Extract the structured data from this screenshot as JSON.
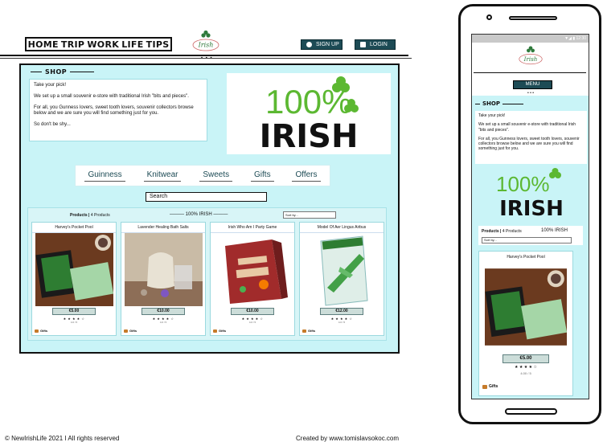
{
  "nav": {
    "items": [
      "HOME",
      "TRIP",
      "WORK",
      "LIFE",
      "TIPS"
    ]
  },
  "header": {
    "signup_label": "SIGN UP",
    "login_label": "LOGIN",
    "logo_text": "Irish",
    "dots": "• • •"
  },
  "shop": {
    "title": "SHOP",
    "intro": [
      "Take your pick!",
      "We set up a small souvenir e-store with traditional Irish \"bits and pieces\".",
      "For all, you Gunness lovers, sweet tooth lovers, souvenir collectors browse below and we are sure you will find something just for you.",
      "So don't be shy..."
    ],
    "banner_top": "100%",
    "banner_bottom": "IRISH",
    "categories": [
      "Guinness",
      "Knitwear",
      "Sweets",
      "Gifts",
      "Offers"
    ],
    "search_placeholder": "Search",
    "products_label": "Products",
    "products_count": "4 Products",
    "center_label": "100% IRISH",
    "sort_placeholder": "Sort by..."
  },
  "products": [
    {
      "title": "Harvey's Pocket Pool",
      "price": "€5.00",
      "stars": "★ ★ ★ ★ ☆",
      "rating": "4.0 / 5",
      "tag": "Gifts"
    },
    {
      "title": "Lavender Healing Bath Salts",
      "price": "€10.00",
      "stars": "★ ★ ★ ★ ☆",
      "rating": "4.0 / 5",
      "tag": "Gifts"
    },
    {
      "title": "Irish Who Am I Party Game",
      "price": "€10.00",
      "stars": "★ ★ ★ ★ ☆",
      "rating": "4.0 / 5",
      "tag": "Gifts"
    },
    {
      "title": "Model Of Aer Lingus Airbus",
      "price": "€12.00",
      "stars": "★ ★ ★ ★ ☆",
      "rating": "4.0 / 5",
      "tag": "Gifts"
    }
  ],
  "mobile": {
    "status": "▼◢ ▮ 12:30",
    "menu_label": "MENU",
    "title": "SHOP",
    "intro": [
      "Take your pick!",
      "We set up a small souvenir e-store with traditional Irish \"bits and pieces\".",
      "For all, you Gunness lovers, sweet tooth lovers, souvenir collectors browse below and we are sure you will find something just for you."
    ],
    "products_label": "Products",
    "products_count": "4 Products",
    "center_label": "100% IRISH",
    "sort_placeholder": "Sort by...",
    "card": {
      "title": "Harvey's Pocket Pool",
      "price": "€5.00",
      "stars": "★ ★ ★ ★ ☆",
      "rating": "4.00 / 5",
      "tag": "Gifts"
    }
  },
  "footer": {
    "left": "© NewIrishLife 2021 I All rights reserved",
    "right": "Created by www.tomislavsokoc.com"
  },
  "colors": {
    "page_bg": "#c9f4f7",
    "button": "#1d4b55",
    "green": "#5cb832",
    "price_bg": "#ccddd9"
  }
}
